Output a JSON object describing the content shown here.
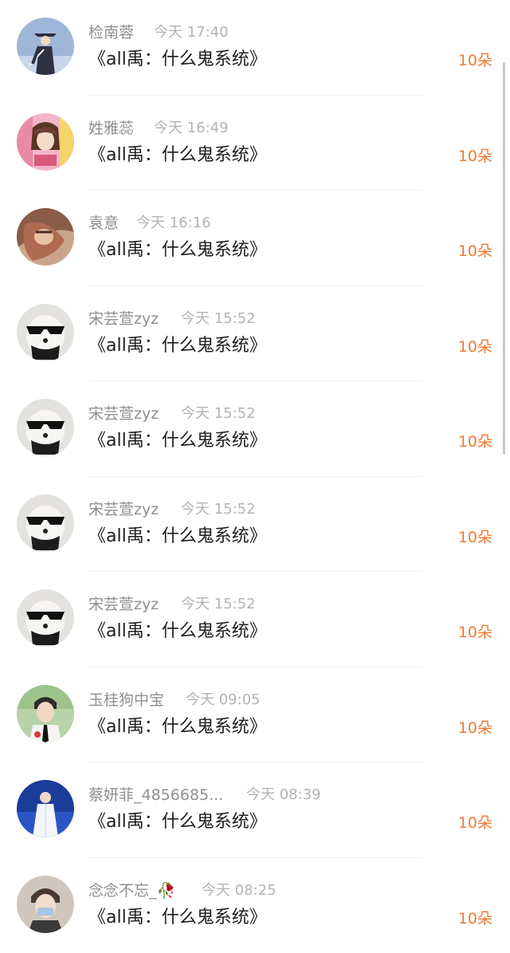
{
  "rows": [
    {
      "name": "检南蓉",
      "time": "今天 17:40",
      "content": "《all禹：什么鬼系统》",
      "gift": "10朵",
      "avatar": "avatar-swordsman"
    },
    {
      "name": "姓雅蕊",
      "time": "今天 16:49",
      "content": "《all禹：什么鬼系统》",
      "gift": "10朵",
      "avatar": "avatar-girl-pink"
    },
    {
      "name": "袁意",
      "time": "今天 16:16",
      "content": "《all禹：什么鬼系统》",
      "gift": "10朵",
      "avatar": "avatar-person-reddish"
    },
    {
      "name": "宋芸萱zyz",
      "time": "今天 15:52",
      "content": "《all禹：什么鬼系统》",
      "gift": "10朵",
      "avatar": "avatar-dog-sunglasses"
    },
    {
      "name": "宋芸萱zyz",
      "time": "今天 15:52",
      "content": "《all禹：什么鬼系统》",
      "gift": "10朵",
      "avatar": "avatar-dog-sunglasses"
    },
    {
      "name": "宋芸萱zyz",
      "time": "今天 15:52",
      "content": "《all禹：什么鬼系统》",
      "gift": "10朵",
      "avatar": "avatar-dog-sunglasses"
    },
    {
      "name": "宋芸萱zyz",
      "time": "今天 15:52",
      "content": "《all禹：什么鬼系统》",
      "gift": "10朵",
      "avatar": "avatar-dog-sunglasses"
    },
    {
      "name": "玉桂狗中宝",
      "time": "今天 09:05",
      "content": "《all禹：什么鬼系统》",
      "gift": "10朵",
      "avatar": "avatar-boy-tie"
    },
    {
      "name": "蔡妍菲_4856685...",
      "time": "今天 08:39",
      "content": "《all禹：什么鬼系统》",
      "gift": "10朵",
      "avatar": "avatar-stage-white"
    },
    {
      "name": "念念不忘_🥀",
      "time": "今天 08:25",
      "content": "《all禹：什么鬼系统》",
      "gift": "10朵",
      "avatar": "avatar-boy-mask"
    }
  ],
  "colors": {
    "gift_accent": "#ee7a33",
    "name_text": "#8f8f8f",
    "time_text": "#b3b3b3",
    "content_text": "#1d1d1d"
  }
}
